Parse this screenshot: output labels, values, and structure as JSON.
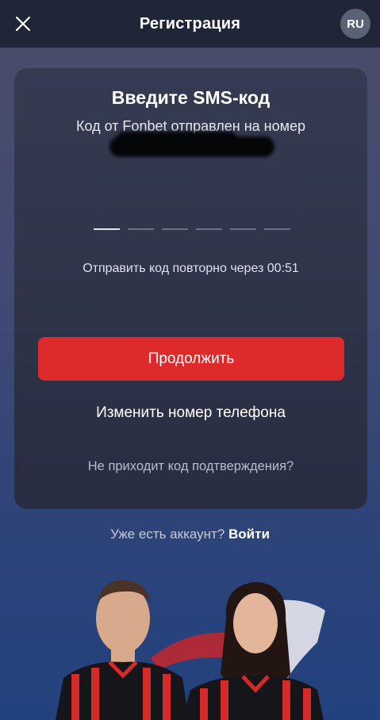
{
  "header": {
    "title": "Регистрация",
    "language": "RU",
    "close_icon": "close-icon"
  },
  "card": {
    "title": "Введите SMS-код",
    "subtitle": "Код от Fonbet отправлен на номер",
    "code_length": 6,
    "resend_text": "Отправить код повторно через 00:51",
    "continue_label": "Продолжить",
    "change_phone_label": "Изменить номер телефона",
    "no_code_label": "Не приходит код подтверждения?"
  },
  "footer": {
    "have_account": "Уже есть аккаунт?",
    "login_label": "Войти"
  },
  "colors": {
    "accent": "#de2a2a",
    "topbar": "#1f2637",
    "card": "#2f3449"
  }
}
